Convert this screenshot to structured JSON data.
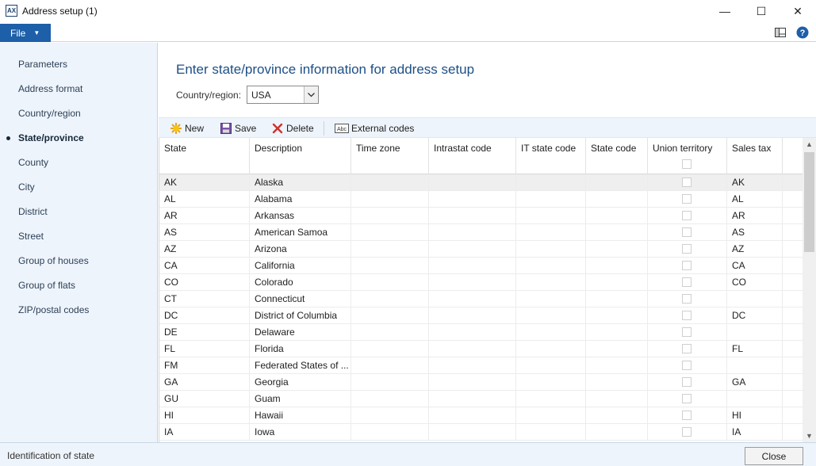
{
  "window": {
    "title": "Address setup (1)",
    "icon": "app-icon",
    "icon_text": "AX",
    "minimize": "—",
    "maximize": "☐",
    "close": "✕"
  },
  "menubar": {
    "file_label": "File",
    "file_caret": "▼",
    "icons": [
      "layout-icon",
      "help-icon"
    ]
  },
  "sidebar": {
    "items": [
      {
        "label": "Parameters",
        "active": false
      },
      {
        "label": "Address format",
        "active": false
      },
      {
        "label": "Country/region",
        "active": false
      },
      {
        "label": "State/province",
        "active": true
      },
      {
        "label": "County",
        "active": false
      },
      {
        "label": "City",
        "active": false
      },
      {
        "label": "District",
        "active": false
      },
      {
        "label": "Street",
        "active": false
      },
      {
        "label": "Group of houses",
        "active": false
      },
      {
        "label": "Group of flats",
        "active": false
      },
      {
        "label": "ZIP/postal codes",
        "active": false
      }
    ]
  },
  "main": {
    "heading": "Enter state/province information for address setup",
    "country_label": "Country/region:",
    "country_value": "USA"
  },
  "toolbar": {
    "new_label": "New",
    "save_label": "Save",
    "delete_label": "Delete",
    "external_label": "External codes",
    "external_icon_text": "Abc"
  },
  "grid": {
    "columns": [
      "State",
      "Description",
      "Time zone",
      "Intrastat code",
      "IT state code",
      "State code",
      "Union territory",
      "Sales tax"
    ],
    "rows": [
      {
        "state": "AK",
        "description": "Alaska",
        "sales_tax": "AK",
        "selected": true
      },
      {
        "state": "AL",
        "description": "Alabama",
        "sales_tax": "AL"
      },
      {
        "state": "AR",
        "description": "Arkansas",
        "sales_tax": "AR"
      },
      {
        "state": "AS",
        "description": "American Samoa",
        "sales_tax": "AS"
      },
      {
        "state": "AZ",
        "description": "Arizona",
        "sales_tax": "AZ"
      },
      {
        "state": "CA",
        "description": "California",
        "sales_tax": "CA"
      },
      {
        "state": "CO",
        "description": "Colorado",
        "sales_tax": "CO"
      },
      {
        "state": "CT",
        "description": "Connecticut",
        "sales_tax": ""
      },
      {
        "state": "DC",
        "description": "District of Columbia",
        "sales_tax": "DC"
      },
      {
        "state": "DE",
        "description": "Delaware",
        "sales_tax": ""
      },
      {
        "state": "FL",
        "description": "Florida",
        "sales_tax": "FL"
      },
      {
        "state": "FM",
        "description": "Federated States of ...",
        "sales_tax": ""
      },
      {
        "state": "GA",
        "description": "Georgia",
        "sales_tax": "GA"
      },
      {
        "state": "GU",
        "description": "Guam",
        "sales_tax": ""
      },
      {
        "state": "HI",
        "description": "Hawaii",
        "sales_tax": "HI"
      },
      {
        "state": "IA",
        "description": "Iowa",
        "sales_tax": "IA"
      }
    ]
  },
  "status": {
    "text": "Identification of state",
    "close_label": "Close"
  },
  "colors": {
    "accent": "#1d5fa8",
    "heading": "#1d4f86",
    "sidebar_bg": "#eef4fb"
  }
}
